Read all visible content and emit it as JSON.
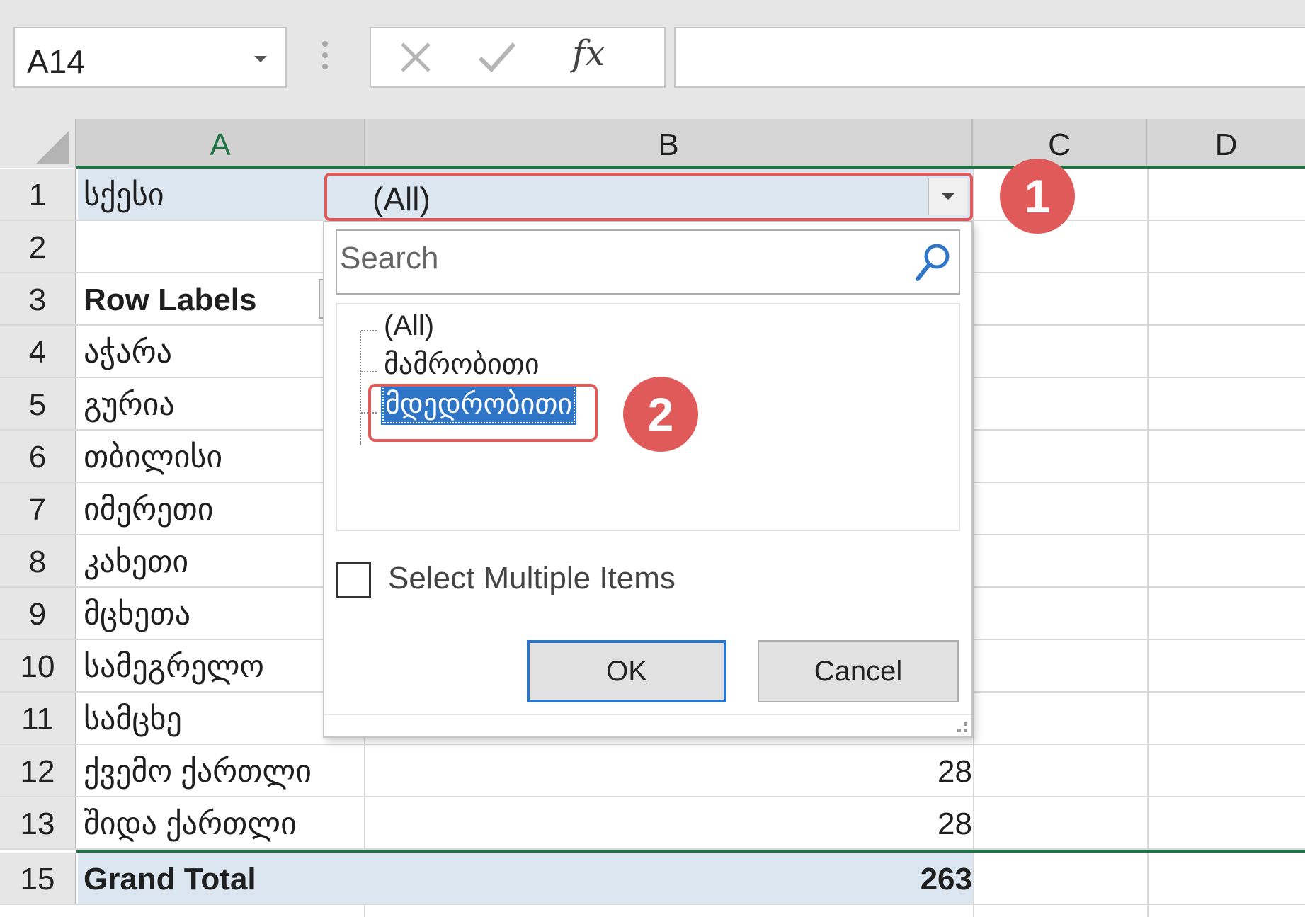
{
  "formula_bar": {
    "name_box": "A14",
    "fx_label": "fx",
    "formula": ""
  },
  "columns": [
    "A",
    "B",
    "C",
    "D"
  ],
  "rows": [
    {
      "num": "1",
      "a": "სქესი",
      "b": ""
    },
    {
      "num": "2",
      "a": "",
      "b": ""
    },
    {
      "num": "3",
      "a": "Row Labels",
      "b": ""
    },
    {
      "num": "4",
      "a": "აჭარა",
      "b": ""
    },
    {
      "num": "5",
      "a": "გურია",
      "b": ""
    },
    {
      "num": "6",
      "a": "თბილისი",
      "b": ""
    },
    {
      "num": "7",
      "a": "იმერეთი",
      "b": ""
    },
    {
      "num": "8",
      "a": "კახეთი",
      "b": ""
    },
    {
      "num": "9",
      "a": "მცხეთა",
      "b": ""
    },
    {
      "num": "10",
      "a": "სამეგრელო",
      "b": ""
    },
    {
      "num": "11",
      "a": "სამცხე",
      "b": ""
    },
    {
      "num": "12",
      "a": "ქვემო ქართლი",
      "b": "28"
    },
    {
      "num": "13",
      "a": "შიდა ქართლი",
      "b": "28"
    },
    {
      "num": "15",
      "a": "Grand Total",
      "b": "263"
    }
  ],
  "filter": {
    "value": "(All)",
    "search_placeholder": "Search",
    "items": [
      "(All)",
      "მამრობითი",
      "მდედრობითი"
    ],
    "selected_index": 2,
    "select_multiple_label": "Select Multiple Items",
    "select_multiple_checked": false,
    "ok_label": "OK",
    "cancel_label": "Cancel"
  },
  "annotations": {
    "badge_1": "1",
    "badge_2": "2"
  },
  "colors": {
    "accent_red": "#e05a5a",
    "selection_blue": "#2e75c7",
    "excel_green": "#217346",
    "pivot_fill": "#dce6f1"
  }
}
